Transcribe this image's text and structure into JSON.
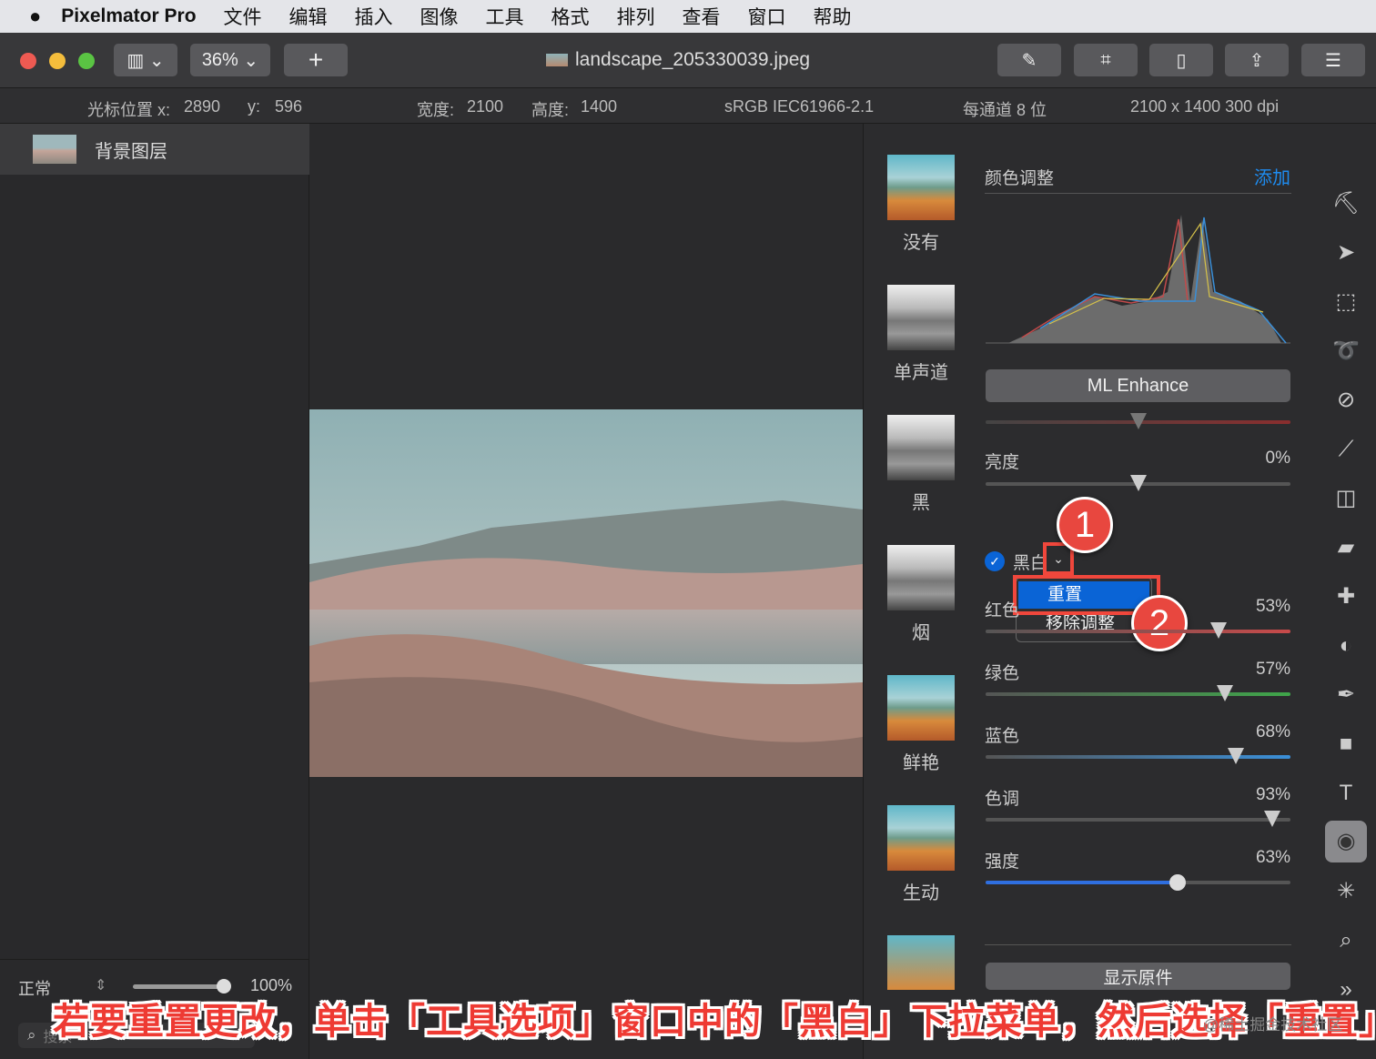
{
  "menubar": {
    "app": "Pixelmator Pro",
    "items": [
      "文件",
      "编辑",
      "插入",
      "图像",
      "工具",
      "格式",
      "排列",
      "查看",
      "窗口",
      "帮助"
    ]
  },
  "toolbar": {
    "zoom": "36%",
    "add": "+",
    "filename": "landscape_205330039.jpeg"
  },
  "infobar": {
    "cursor_x_label": "光标位置 x:",
    "cursor_x": "2890",
    "cursor_y_label": "y:",
    "cursor_y": "596",
    "width_label": "宽度:",
    "width": "2100",
    "height_label": "高度:",
    "height": "1400",
    "color_profile": "sRGB IEC61966-2.1",
    "bit_depth": "每通道 8 位",
    "resolution": "2100 x 1400 300 dpi"
  },
  "layers": {
    "items": [
      {
        "name": "背景图层"
      }
    ],
    "blend_mode": "正常",
    "opacity": "100%",
    "search_placeholder": "搜索"
  },
  "presets": [
    {
      "name": "没有",
      "type": "color"
    },
    {
      "name": "单声道",
      "type": "bw"
    },
    {
      "name": "黑",
      "type": "bw"
    },
    {
      "name": "烟",
      "type": "bw"
    },
    {
      "name": "鲜艳",
      "type": "color"
    },
    {
      "name": "生动",
      "type": "color"
    }
  ],
  "adjustments": {
    "title": "颜色调整",
    "add_label": "添加",
    "ml_enhance": "ML Enhance",
    "brightness": {
      "label": "亮度",
      "value": "0%",
      "position": 0.5
    },
    "bw": {
      "label": "黑白",
      "enabled": true
    },
    "menu": {
      "items": [
        "重置",
        "移除调整"
      ],
      "selected": "重置"
    },
    "sliders": [
      {
        "label": "红色",
        "value": "53%",
        "position": 0.765,
        "color": "#c84a4a"
      },
      {
        "label": "绿色",
        "value": "57%",
        "position": 0.785,
        "color": "#3fa64a"
      },
      {
        "label": "蓝色",
        "value": "68%",
        "position": 0.82,
        "color": "#3a8fd8"
      },
      {
        "label": "色调",
        "value": "93%",
        "position": 0.94,
        "color": "#555555"
      },
      {
        "label": "强度",
        "value": "63%",
        "position": 0.63,
        "color": "#2f6fe0"
      }
    ],
    "show_original": "显示原件"
  },
  "tools": [
    "paint-bucket",
    "arrow",
    "rect-select",
    "lasso",
    "color-picker",
    "brush",
    "bucket",
    "eraser",
    "bandage",
    "dodge",
    "pen",
    "shape",
    "text",
    "color-adjust",
    "effects",
    "zoom",
    "more"
  ],
  "annotations": {
    "step1": "1",
    "step2": "2",
    "caption": "若要重置更改，单击「工具选项」窗口中的「黑白」下拉菜单，然后选择「重置」",
    "watermark": "@稀土掘金技术社区"
  },
  "colors": {
    "accent": "#0a64d6",
    "annotation": "#ee3a33"
  }
}
